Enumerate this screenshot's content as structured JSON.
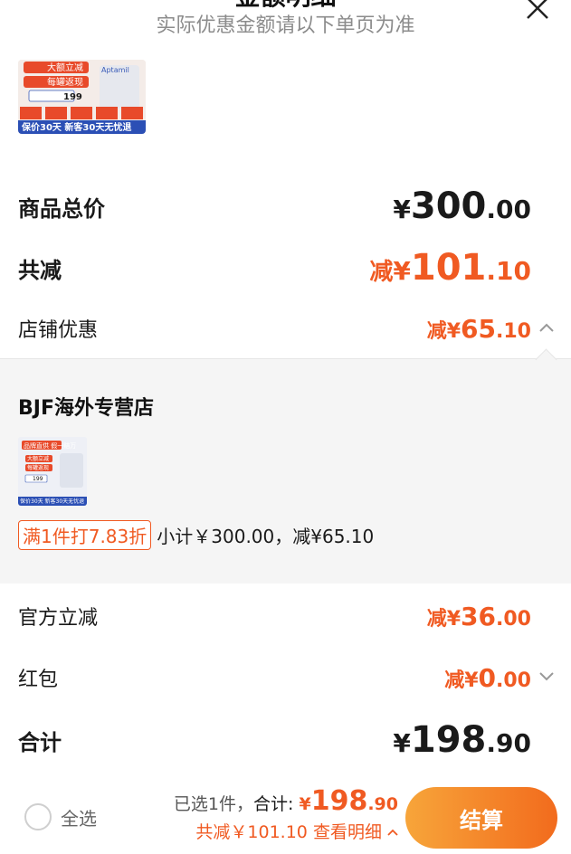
{
  "header": {
    "title": "金额明细",
    "subtitle": "实际优惠金额请以下单页为准"
  },
  "product_top_image": {
    "texts": [
      "大额立减",
      "每罐返现",
      "199",
      "Aptamil",
      "保价30天 新客30天无忧退"
    ]
  },
  "summary": {
    "goods_total": {
      "label": "商品总价",
      "yen": "¥",
      "int": "300",
      "dec": ".00"
    },
    "total_discount": {
      "label": "共减",
      "prefix": "减",
      "yen": "¥",
      "int": "101",
      "dec": ".10"
    },
    "shop_discount": {
      "label": "店铺优惠",
      "prefix": "减",
      "yen": "¥",
      "int": "65",
      "dec": ".10"
    }
  },
  "shop_panel": {
    "shop_name": "BJF海外专营店",
    "promo_tag": "满1件打7.83折",
    "promo_detail": "小计￥300.00，减¥65.10",
    "thumb_texts": [
      "品牌直供 假一赔万",
      "大额立减",
      "每罐返现",
      "199",
      "保价30天 新客30天无忧退"
    ]
  },
  "official_discount": {
    "label": "官方立减",
    "prefix": "减",
    "yen": "¥",
    "int": "36",
    "dec": ".00"
  },
  "red_packet": {
    "label": "红包",
    "prefix": "减",
    "yen": "¥",
    "int": "0",
    "dec": ".00"
  },
  "grand_total": {
    "label": "合计",
    "yen": "¥",
    "int": "198",
    "dec": ".90"
  },
  "bottom_bar": {
    "select_all": "全选",
    "selected_count": "已选1件，",
    "total_label": "合计:",
    "total_yen": "¥",
    "total_int": "198",
    "total_dec": ".90",
    "discount_text": "共减￥101.10",
    "view_detail": "查看明细",
    "checkout": "结算"
  },
  "colors": {
    "accent": "#f05a22",
    "button_gradient_start": "#f7a53a",
    "button_gradient_end": "#f26b1d",
    "panel_bg": "#f5f5f5"
  },
  "icons": {
    "close": "close-icon",
    "shop_expand": "chevron-up-icon",
    "red_packet_expand": "chevron-down-icon",
    "detail_toggle": "chevron-up-icon"
  }
}
